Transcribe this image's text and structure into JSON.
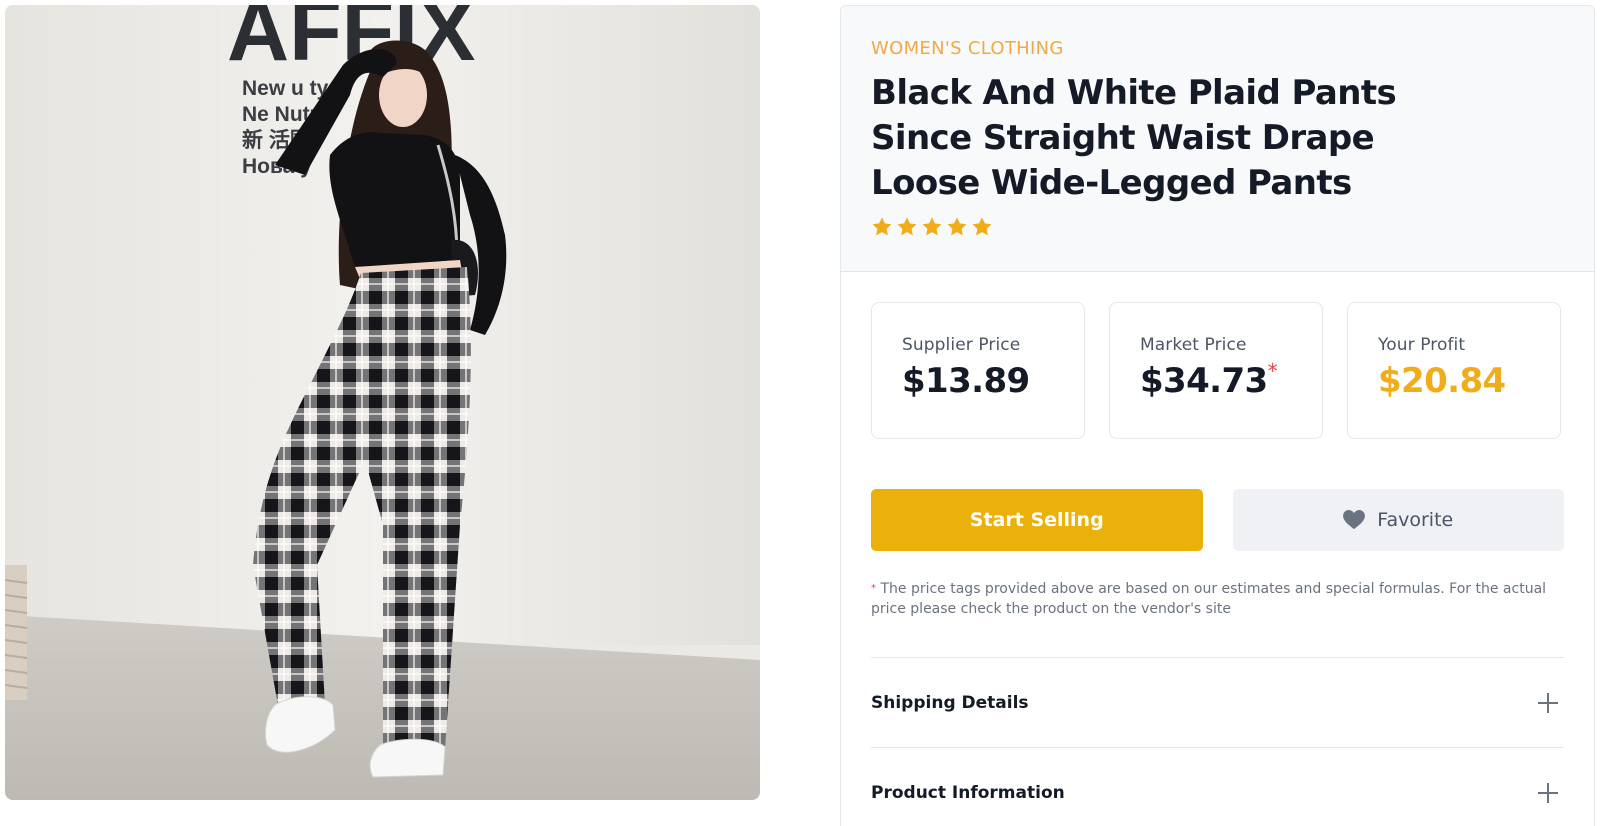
{
  "product": {
    "category": "WOMEN'S CLOTHING",
    "title": "Black And White Plaid Pants Since Straight Waist Drape Loose Wide-Legged Pants",
    "rating": 5,
    "rating_max": 5,
    "image": {
      "wall_sign_brand": "AFFIX",
      "wall_sign_lines": [
        "New u    ty",
        "Ne    Nutz",
        "新       活围",
        "Нова у"
      ]
    }
  },
  "prices": {
    "supplier": {
      "label": "Supplier Price",
      "value": "$13.89"
    },
    "market": {
      "label": "Market Price",
      "value": "$34.73",
      "marker": "*"
    },
    "profit": {
      "label": "Your Profit",
      "value": "$20.84"
    }
  },
  "actions": {
    "start_selling": "Start Selling",
    "favorite": "Favorite",
    "favorite_icon": "heart-icon"
  },
  "disclaimer": {
    "marker": "*",
    "text": "The price tags provided above are based on our estimates and special formulas. For the actual price please check the product on the vendor's site"
  },
  "accordion": [
    {
      "label": "Shipping Details",
      "icon": "plus-icon"
    },
    {
      "label": "Product Information",
      "icon": "plus-icon"
    }
  ],
  "colors": {
    "accent": "#ebb10b",
    "category": "#f0a944",
    "profit": "#f0ad19",
    "star": "#f0ad19",
    "asterisk": "#ef4444"
  }
}
